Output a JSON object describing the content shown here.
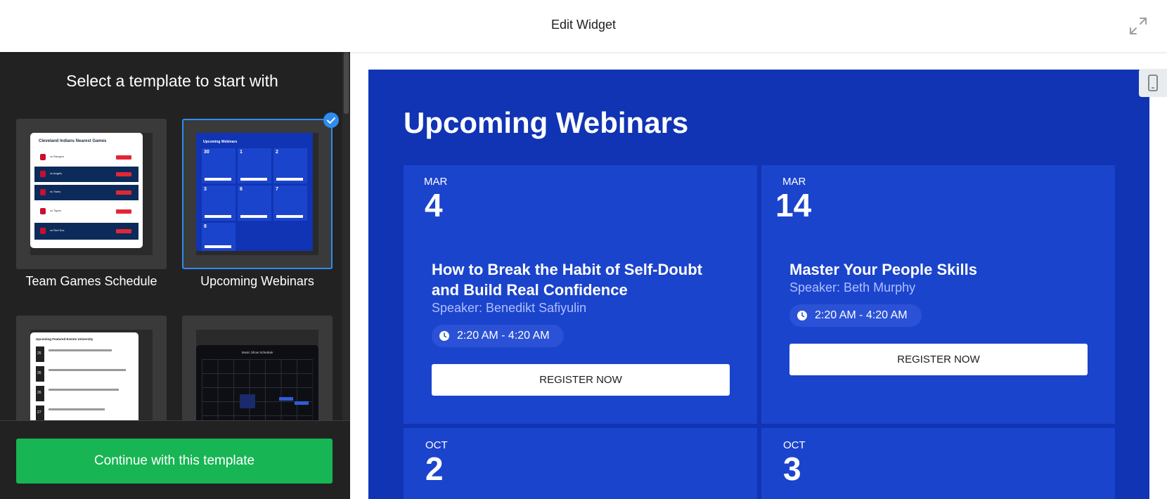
{
  "header": {
    "title": "Edit Widget",
    "expand_icon": "expand-arrows-icon"
  },
  "sidebar": {
    "heading": "Select a template to start with",
    "templates": [
      {
        "label": "Team Games Schedule",
        "selected": false
      },
      {
        "label": "Upcoming Webinars",
        "selected": true
      },
      {
        "label": "",
        "selected": false
      },
      {
        "label": "",
        "selected": false
      }
    ],
    "continue_label": "Continue with this template"
  },
  "thumbs": {
    "team": {
      "title": "Cleveland Indians Nearest Games",
      "games": [
        "vs Rangers",
        "vs Angels",
        "vs Twins",
        "vs Tigers",
        "vs Red Sox"
      ]
    },
    "webinars": {
      "title": "Upcoming Webinars",
      "days": [
        "30",
        "1",
        "2",
        "3",
        "6",
        "7",
        "8"
      ]
    },
    "events": {
      "title": "Upcoming Featured Events University",
      "days": [
        "25",
        "26",
        "26",
        "27"
      ]
    },
    "calendar": {
      "title": "Music Show Schedule"
    }
  },
  "preview": {
    "title": "Upcoming Webinars",
    "device_icon": "mobile-device-icon",
    "events": [
      {
        "month": "MAR",
        "day": "4",
        "title": "How to Break the Habit of Self-Doubt and Build Real Confidence",
        "speaker": "Speaker: Benedikt Safiyulin",
        "time": "2:20 AM - 4:20 AM",
        "button": "REGISTER NOW"
      },
      {
        "month": "MAR",
        "day": "14",
        "title": "Master Your People Skills",
        "speaker": "Speaker: Beth Murphy",
        "time": "2:20 AM - 4:20 AM",
        "button": "REGISTER NOW"
      },
      {
        "month": "OCT",
        "day": "2"
      },
      {
        "month": "OCT",
        "day": "3"
      }
    ]
  },
  "colors": {
    "accent_blue": "#1034b3",
    "card_blue": "#1b44cc",
    "continue_green": "#17b553",
    "select_blue": "#2f8cf0"
  }
}
